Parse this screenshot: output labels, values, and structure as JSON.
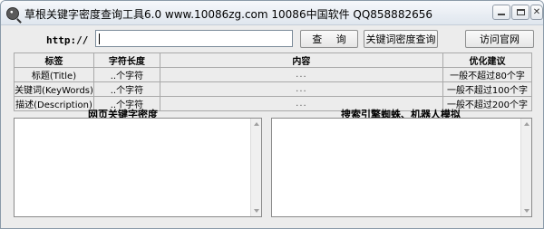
{
  "window": {
    "title": "草根关键字密度查询工具6.0   www.10086zg.com  10086中国软件    QQ858882656"
  },
  "toolbar": {
    "url_label": "http://",
    "url_value": "",
    "query_label": "查 询",
    "density_label": "关键词密度查询",
    "site_label": "访问官网"
  },
  "table": {
    "headers": [
      "标签",
      "字符长度",
      "内容",
      "优化建议"
    ],
    "rows": [
      {
        "tag": "标题(Title)",
        "length": "..个字符",
        "content": "...",
        "advice": "一般不超过80个字"
      },
      {
        "tag": "关键词(KeyWords)",
        "length": "..个字符",
        "content": "...",
        "advice": "一般不超过100个字"
      },
      {
        "tag": "描述(Description)",
        "length": "..个字符",
        "content": "...",
        "advice": "一般不超过200个字"
      }
    ]
  },
  "panes": {
    "left_title": "网页关键字密度",
    "right_title": "搜索引擎蜘蛛、机器人模拟"
  }
}
